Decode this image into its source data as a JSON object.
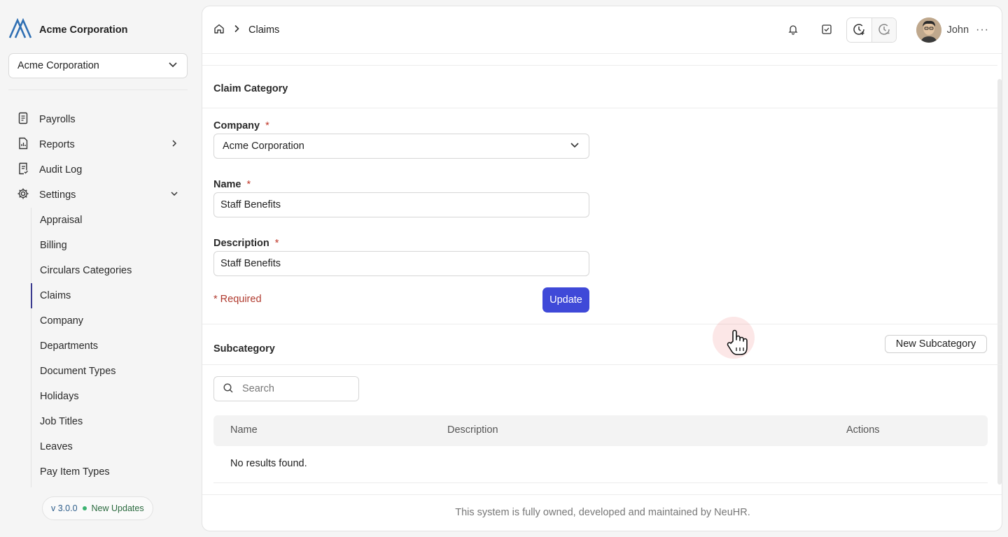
{
  "sidebar": {
    "brand": "Acme Corporation",
    "company_select": "Acme Corporation",
    "nav": [
      {
        "label": "Payrolls",
        "icon": "payroll-icon"
      },
      {
        "label": "Reports",
        "icon": "report-icon"
      },
      {
        "label": "Audit Log",
        "icon": "audit-log-icon"
      },
      {
        "label": "Settings",
        "icon": "gear-icon"
      }
    ],
    "settings_items": [
      "Appraisal",
      "Billing",
      "Circulars Categories",
      "Claims",
      "Company",
      "Departments",
      "Document Types",
      "Holidays",
      "Job Titles",
      "Leaves",
      "Pay Item Types"
    ],
    "active_settings_item": "Claims",
    "version": "v 3.0.0",
    "updates": "New Updates"
  },
  "header": {
    "breadcrumb_current": "Claims",
    "user_name": "John"
  },
  "form": {
    "section_title": "Claim Category",
    "company_label": "Company",
    "company_value": "Acme Corporation",
    "name_label": "Name",
    "name_value": "Staff Benefits",
    "description_label": "Description",
    "description_value": "Staff Benefits",
    "required_star": "*",
    "required_note": "* Required",
    "update_button": "Update"
  },
  "subcategory": {
    "title": "Subcategory",
    "new_button": "New Subcategory",
    "search_placeholder": "Search",
    "columns": [
      "Name",
      "Description",
      "Actions"
    ],
    "empty_text": "No results found."
  },
  "footer": "This system is fully owned, developed and maintained by NeuHR.",
  "colors": {
    "accent": "#3f49d8",
    "required": "#b03a2e",
    "brand": "#2f6fb3"
  }
}
